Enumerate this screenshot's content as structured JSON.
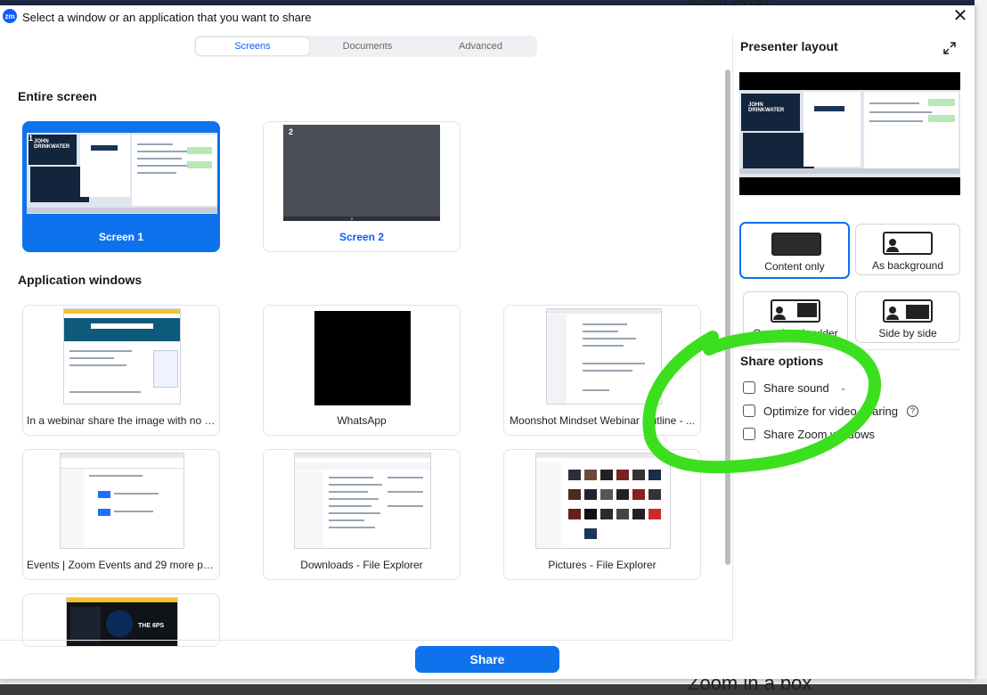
{
  "dialog": {
    "title": "Select a window or an application that you want to share",
    "logo_text": "zm",
    "close_glyph": "✕"
  },
  "tabs": [
    {
      "label": "Screens",
      "active": true
    },
    {
      "label": "Documents",
      "active": false
    },
    {
      "label": "Advanced",
      "active": false
    }
  ],
  "entire_screen": {
    "heading": "Entire screen",
    "screens": [
      {
        "label": "Screen 1",
        "number": "1",
        "selected": true
      },
      {
        "label": "Screen 2",
        "number": "2",
        "selected": false
      }
    ]
  },
  "app_windows": {
    "heading": "Application windows",
    "items": [
      {
        "label": "In a webinar share the image with no a..."
      },
      {
        "label": "WhatsApp"
      },
      {
        "label": "Moonshot Mindset Webinar Outline - ..."
      },
      {
        "label": "Events | Zoom Events and 29 more pag..."
      },
      {
        "label": "Downloads - File Explorer"
      },
      {
        "label": "Pictures - File Explorer"
      },
      {
        "label": ""
      }
    ]
  },
  "footer": {
    "share_label": "Share"
  },
  "presenter": {
    "title": "Presenter layout",
    "layouts": [
      {
        "label": "Content only",
        "active": true
      },
      {
        "label": "As background",
        "active": false
      },
      {
        "label": "Over the shoulder",
        "active": false
      },
      {
        "label": "Side by side",
        "active": false
      }
    ]
  },
  "share_options": {
    "heading": "Share options",
    "options": [
      {
        "label": "Share sound",
        "checked": false,
        "has_dropdown": true
      },
      {
        "label": "Optimize for video sharing",
        "checked": false,
        "has_help": true
      },
      {
        "label": "Share Zoom windows",
        "checked": false
      }
    ],
    "help_glyph": "?",
    "dropdown_glyph": "⌄"
  },
  "background_app": {
    "top_text": "New chat",
    "bottom_text": "Zoom in a box"
  },
  "thumb_text": {
    "john": "JOHN",
    "drinkwater": "DRINKWATER",
    "the6ps": "THE 6PS"
  },
  "colors": {
    "accent": "#0e72ed",
    "annotation": "#3cdf1e",
    "dark_screen": "#4a4f57"
  },
  "icons": {
    "expand": "expand-icon",
    "help": "help-icon",
    "dropdown": "chevron-down-icon"
  }
}
